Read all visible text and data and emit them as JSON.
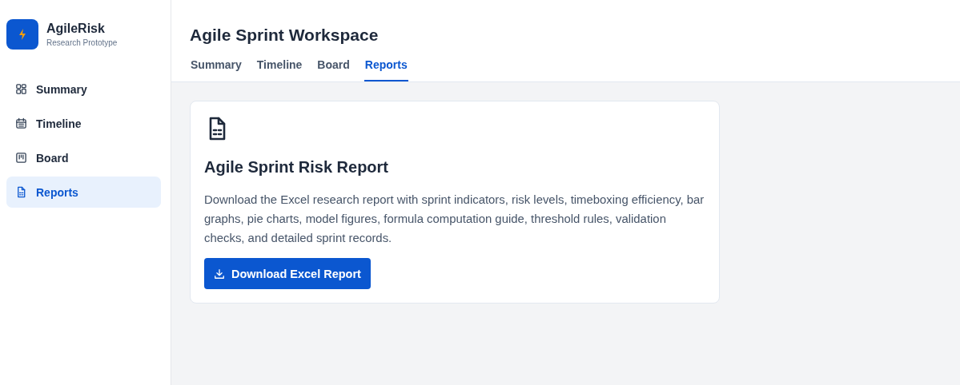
{
  "brand": {
    "name": "AgileRisk",
    "subtitle": "Research Prototype"
  },
  "sidebar": {
    "items": [
      {
        "label": "Summary",
        "kind": "grid",
        "selected": false
      },
      {
        "label": "Timeline",
        "kind": "calendar",
        "selected": false
      },
      {
        "label": "Board",
        "kind": "board",
        "selected": false
      },
      {
        "label": "Reports",
        "kind": "document",
        "selected": true
      }
    ]
  },
  "header": {
    "title": "Agile Sprint Workspace"
  },
  "tabs": [
    {
      "label": "Summary",
      "selected": false
    },
    {
      "label": "Timeline",
      "selected": false
    },
    {
      "label": "Board",
      "selected": false
    },
    {
      "label": "Reports",
      "selected": true
    }
  ],
  "report_card": {
    "title": "Agile Sprint Risk Report",
    "description": "Download the Excel research report with sprint indicators, risk levels, timeboxing efficiency, bar graphs, pie charts, model figures, formula computation guide, threshold rules, validation checks, and detailed sprint records.",
    "button": "Download Excel Report"
  }
}
